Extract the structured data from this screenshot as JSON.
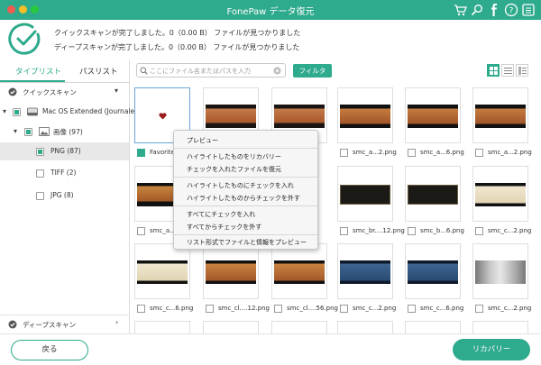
{
  "window": {
    "title": "FonePaw データ復元"
  },
  "status": {
    "quick_scan": "クイックスキャンが完了しました。0（0.00 B） ファイルが見つかりました",
    "deep_scan": "ディープスキャンが完了しました。0（0.00 B） ファイルが見つかりました"
  },
  "tabs": {
    "type_list": "タイプリスト",
    "path_list": "パスリスト"
  },
  "tree": {
    "quick_scan": "クイックスキャン",
    "volume": "Mac OS Extended (Journaled)",
    "images": "画像 (97)",
    "png": "PNG (87)",
    "tiff": "TIFF (2)",
    "jpg": "JPG (8)",
    "deep_scan": "ディープスキャン"
  },
  "toolbar": {
    "search_placeholder": "ここにファイル名またはパスを入力",
    "filter_label": "フィルタ"
  },
  "grid": {
    "row1": [
      "Favorites...",
      "",
      "",
      "smc_a...2.png",
      "smc_a...6.png",
      "smc_a...2.png"
    ],
    "row2": [
      "smc_a...6.png",
      "",
      "",
      "smc_br....12.png",
      "smc_b...6.png",
      "smc_c...2.png"
    ],
    "row3": [
      "smc_c...6.png",
      "smc_cl....12.png",
      "smc_cl....56.png",
      "smc_c...2.png",
      "smc_c...6.png",
      "smc_c...2.png"
    ]
  },
  "context_menu": {
    "preview": "プレビュー",
    "recover_highlighted": "ハイライトしたものをリカバリー",
    "recover_checked": "チェックを入れたファイルを復元",
    "check_highlighted": "ハイライトしたものにチェックを入れ",
    "uncheck_highlighted": "ハイライトしたものからチェックを外す",
    "check_all": "すべてにチェックを入れ",
    "uncheck_all": "すべてからチェックを外す",
    "list_preview": "リスト形式でファイルと情報をプレビュー"
  },
  "buttons": {
    "back": "戻る",
    "recover": "リカバリー"
  },
  "colors": {
    "accent": "#2eaa8c",
    "selection": "#6aa7d8"
  }
}
